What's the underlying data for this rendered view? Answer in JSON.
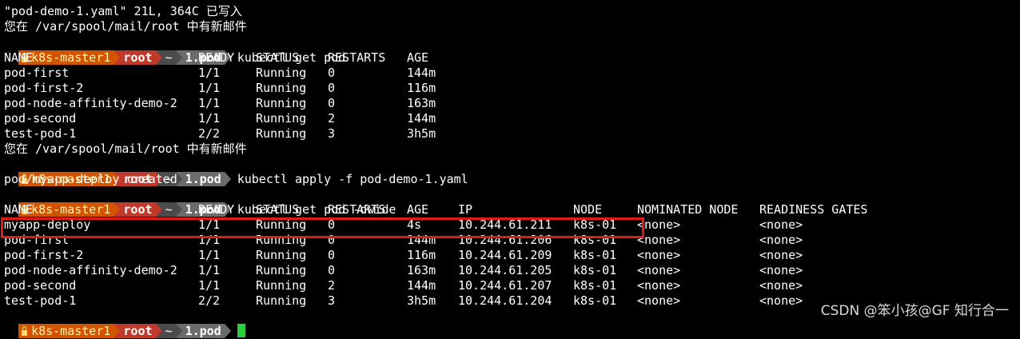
{
  "colors": {
    "background": "#000000",
    "foreground": "#ffffff",
    "prompt_user_bg": "#d35400",
    "prompt_root_bg": "#c0392b",
    "prompt_home_bg": "#4b4b4b",
    "prompt_dir_bg": "#6b6b6b",
    "highlight_box": "#e01919",
    "cursor": "#2ecc40"
  },
  "prompt": {
    "lock_icon": "lock-icon",
    "user": "k8s-master1",
    "root": "root",
    "home": "~",
    "dir": "1.pod"
  },
  "lines": {
    "l1": "\"pod-demo-1.yaml\" 21L, 364C 已写入",
    "l2": "您在 /var/spool/mail/root 中有新邮件",
    "cmd1": "kubectl get pod",
    "l10": "您在 /var/spool/mail/root 中有新邮件",
    "cmd2": "kubectl apply -f pod-demo-1.yaml",
    "l12": "pod/myapp-deploy created",
    "cmd3": "kubectl get pod -owide"
  },
  "table1": {
    "headers": [
      "NAME",
      "READY",
      "STATUS",
      "RESTARTS",
      "AGE"
    ],
    "rows": [
      [
        "pod-first",
        "1/1",
        "Running",
        "0",
        "144m"
      ],
      [
        "pod-first-2",
        "1/1",
        "Running",
        "0",
        "116m"
      ],
      [
        "pod-node-affinity-demo-2",
        "1/1",
        "Running",
        "0",
        "163m"
      ],
      [
        "pod-second",
        "1/1",
        "Running",
        "2",
        "144m"
      ],
      [
        "test-pod-1",
        "2/2",
        "Running",
        "3",
        "3h5m"
      ]
    ]
  },
  "table2": {
    "headers": [
      "NAME",
      "READY",
      "STATUS",
      "RESTARTS",
      "AGE",
      "IP",
      "NODE",
      "NOMINATED NODE",
      "READINESS GATES"
    ],
    "rows": [
      [
        "myapp-deploy",
        "1/1",
        "Running",
        "0",
        "4s",
        "10.244.61.211",
        "k8s-01",
        "<none>",
        "<none>"
      ],
      [
        "pod-first",
        "1/1",
        "Running",
        "0",
        "144m",
        "10.244.61.206",
        "k8s-01",
        "<none>",
        "<none>"
      ],
      [
        "pod-first-2",
        "1/1",
        "Running",
        "0",
        "116m",
        "10.244.61.209",
        "k8s-01",
        "<none>",
        "<none>"
      ],
      [
        "pod-node-affinity-demo-2",
        "1/1",
        "Running",
        "0",
        "163m",
        "10.244.61.205",
        "k8s-01",
        "<none>",
        "<none>"
      ],
      [
        "pod-second",
        "1/1",
        "Running",
        "2",
        "144m",
        "10.244.61.207",
        "k8s-01",
        "<none>",
        "<none>"
      ],
      [
        "test-pod-1",
        "2/2",
        "Running",
        "3",
        "3h5m",
        "10.244.61.204",
        "k8s-01",
        "<none>",
        "<none>"
      ]
    ]
  },
  "watermark": "CSDN @笨小孩@GF 知行合一"
}
